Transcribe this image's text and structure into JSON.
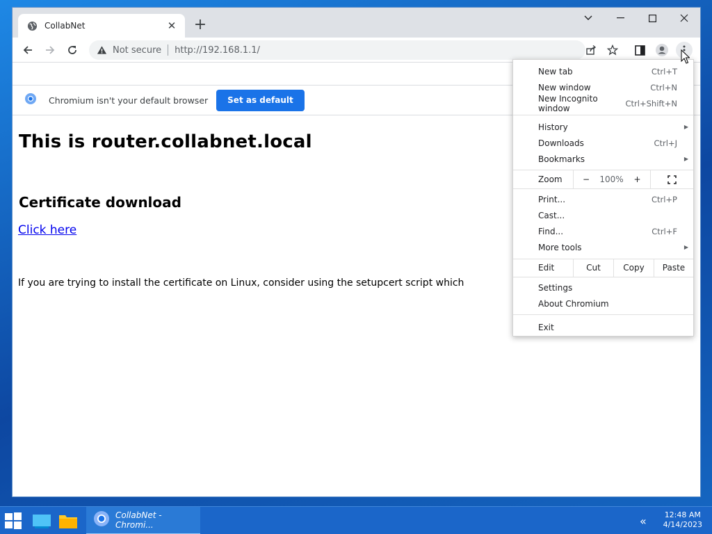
{
  "browser": {
    "tab_title": "CollabNet",
    "security_label": "Not secure",
    "url": "http://192.168.1.1/"
  },
  "infobar": {
    "message": "Chromium isn't your default browser",
    "button_label": "Set as default"
  },
  "page": {
    "heading": "This is router.collabnet.local",
    "subheading": "Certificate download",
    "link_text": "Click here",
    "paragraph": "If you are trying to install the certificate on Linux, consider using the setupcert script which"
  },
  "menu": {
    "new_tab": "New tab",
    "new_tab_sc": "Ctrl+T",
    "new_window": "New window",
    "new_window_sc": "Ctrl+N",
    "incognito": "New Incognito window",
    "incognito_sc": "Ctrl+Shift+N",
    "history": "History",
    "downloads": "Downloads",
    "downloads_sc": "Ctrl+J",
    "bookmarks": "Bookmarks",
    "zoom_label": "Zoom",
    "zoom_minus": "−",
    "zoom_value": "100%",
    "zoom_plus": "+",
    "print": "Print...",
    "print_sc": "Ctrl+P",
    "cast": "Cast...",
    "find": "Find...",
    "find_sc": "Ctrl+F",
    "more_tools": "More tools",
    "edit": "Edit",
    "cut": "Cut",
    "copy": "Copy",
    "paste": "Paste",
    "settings": "Settings",
    "about": "About Chromium",
    "exit": "Exit"
  },
  "taskbar": {
    "app_label": "CollabNet - Chromi...",
    "time": "12:48 AM",
    "date": "4/14/2023"
  },
  "colors": {
    "accent": "#1a73e8",
    "link": "#0000ee",
    "taskbar": "#1b66c9"
  }
}
